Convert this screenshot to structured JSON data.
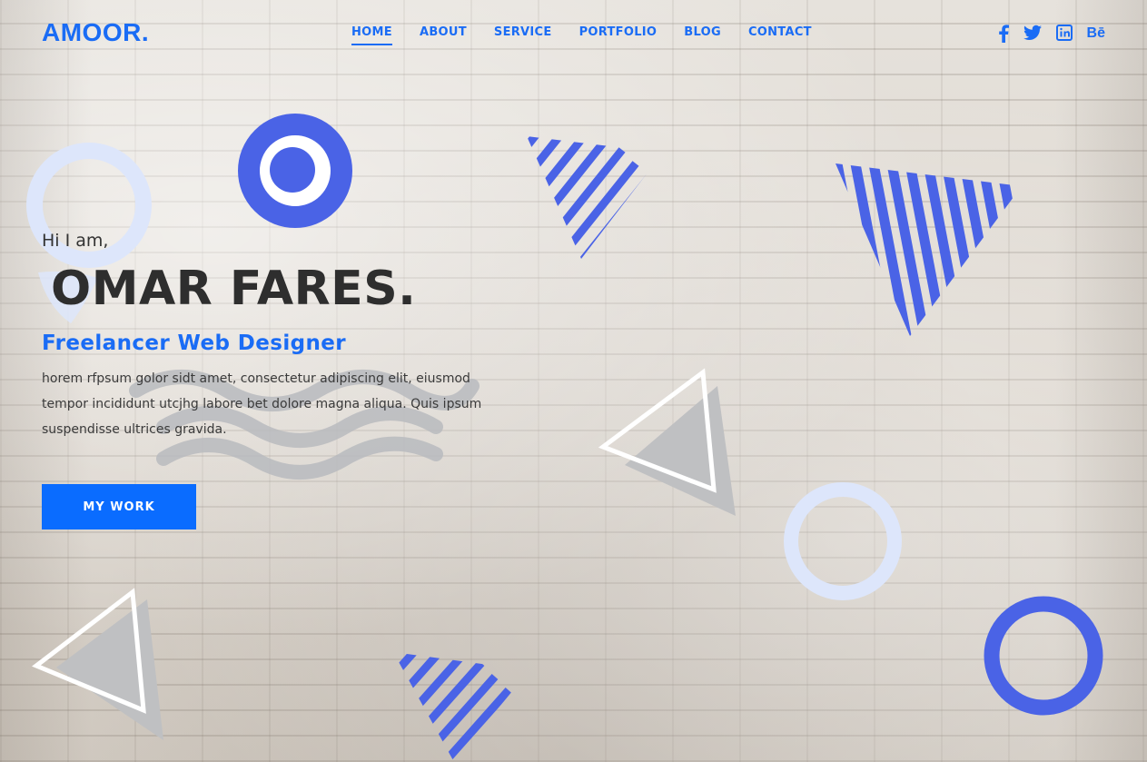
{
  "brand": {
    "logo": "AMOOR.",
    "accent_color": "#1a6cf5",
    "shape_color": "#4a63e6"
  },
  "nav": {
    "items": [
      {
        "label": "HOME",
        "active": true
      },
      {
        "label": "ABOUT",
        "active": false
      },
      {
        "label": "SERVICE",
        "active": false
      },
      {
        "label": "PORTFOLIO",
        "active": false
      },
      {
        "label": "BLOG",
        "active": false
      },
      {
        "label": "CONTACT",
        "active": false
      }
    ]
  },
  "social": [
    {
      "icon": "facebook-icon"
    },
    {
      "icon": "twitter-icon"
    },
    {
      "icon": "linkedin-icon"
    },
    {
      "icon": "behance-icon",
      "label": "Bē"
    }
  ],
  "hero": {
    "greeting": "Hi I am,",
    "name": "OMAR FARES.",
    "role": "Freelancer Web Designer",
    "bio": "horem rfpsum golor sidt amet, consectetur adipiscing elit, eiusmod tempor incididunt utcjhg labore bet dolore magna aliqua. Quis ipsum suspendisse ultrices gravida.",
    "cta_label": "MY WORK"
  }
}
